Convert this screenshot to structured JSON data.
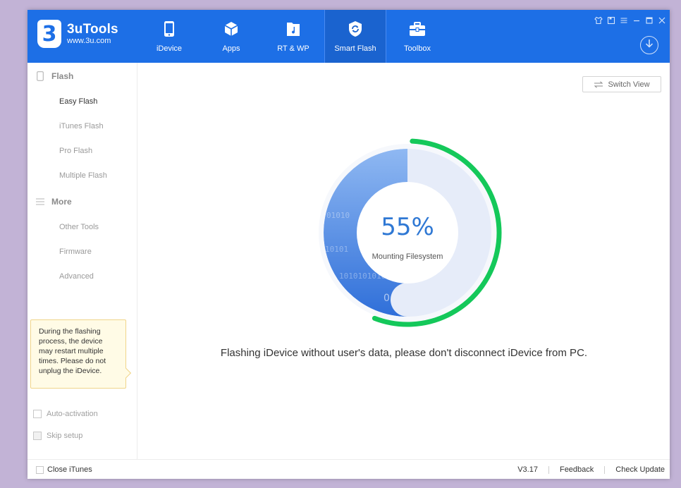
{
  "app": {
    "logo_mark": "3",
    "title": "3uTools",
    "subtitle": "www.3u.com"
  },
  "nav": {
    "items": [
      {
        "label": "iDevice",
        "icon": "phone-icon"
      },
      {
        "label": "Apps",
        "icon": "cube-icon"
      },
      {
        "label": "RT & WP",
        "icon": "music-file-icon"
      },
      {
        "label": "Smart Flash",
        "icon": "shield-flash-icon",
        "active": true
      },
      {
        "label": "Toolbox",
        "icon": "toolbox-icon"
      }
    ]
  },
  "sidebar": {
    "flash_heading": "Flash",
    "flash_items": [
      "Easy Flash",
      "iTunes Flash",
      "Pro Flash",
      "Multiple Flash"
    ],
    "more_heading": "More",
    "more_items": [
      "Other Tools",
      "Firmware",
      "Advanced"
    ],
    "tip": "During the flashing process, the device may restart multiple times. Please do not unplug the iDevice.",
    "auto_activation": "Auto-activation",
    "skip_setup": "Skip setup"
  },
  "main": {
    "switch_view": "Switch View",
    "progress_percent": 55,
    "progress_label": "55%",
    "stage": "Mounting Filesystem",
    "message": "Flashing iDevice without user's data, please don't disconnect iDevice from PC.",
    "binary_lines": [
      "01010",
      "10101",
      "1010101010",
      "0"
    ]
  },
  "footer": {
    "close_itunes": "Close iTunes",
    "version": "V3.17",
    "feedback": "Feedback",
    "check_update": "Check Update"
  },
  "colors": {
    "header_blue": "#1d6fe6",
    "progress_green": "#14c85a",
    "percent_blue": "#2f78d4",
    "tip_bg": "#fffbe6"
  }
}
